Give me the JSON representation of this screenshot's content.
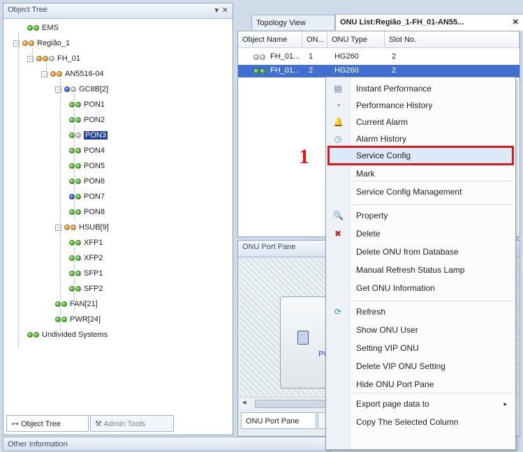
{
  "object_tree": {
    "title": "Object Tree",
    "pin_glyph": "▾",
    "close_glyph": "✕",
    "nodes": [
      {
        "label": "EMS",
        "dots": [
          "g",
          "g"
        ],
        "expander": ""
      },
      {
        "label": "Região_1",
        "dots": [
          "y",
          "y"
        ],
        "expander": "-"
      },
      {
        "label": "FH_01",
        "dots": [
          "y",
          "y",
          "w"
        ],
        "expander": "-"
      },
      {
        "label": "AN5516-04",
        "dots": [
          "y",
          "y"
        ],
        "expander": "-"
      },
      {
        "label": "GC8B[2]",
        "dots": [
          "b",
          "w"
        ],
        "expander": "-"
      },
      {
        "label": "PON1",
        "dots": [
          "g",
          "g"
        ],
        "expander": ""
      },
      {
        "label": "PON2",
        "dots": [
          "g",
          "g"
        ],
        "expander": ""
      },
      {
        "label": "PON3",
        "dots": [
          "g",
          "w"
        ],
        "expander": "",
        "selected": true
      },
      {
        "label": "PON4",
        "dots": [
          "g",
          "g"
        ],
        "expander": ""
      },
      {
        "label": "PON5",
        "dots": [
          "g",
          "g"
        ],
        "expander": ""
      },
      {
        "label": "PON6",
        "dots": [
          "g",
          "g"
        ],
        "expander": ""
      },
      {
        "label": "PON7",
        "dots": [
          "b",
          "g"
        ],
        "expander": ""
      },
      {
        "label": "PON8",
        "dots": [
          "g",
          "g"
        ],
        "expander": ""
      },
      {
        "label": "HSUB[9]",
        "dots": [
          "y",
          "y"
        ],
        "expander": "-"
      },
      {
        "label": "XFP1",
        "dots": [
          "g",
          "g"
        ],
        "expander": ""
      },
      {
        "label": "XFP2",
        "dots": [
          "g",
          "g"
        ],
        "expander": ""
      },
      {
        "label": "SFP1",
        "dots": [
          "g",
          "g"
        ],
        "expander": ""
      },
      {
        "label": "SFP2",
        "dots": [
          "g",
          "g"
        ],
        "expander": ""
      },
      {
        "label": "FAN[21]",
        "dots": [
          "g",
          "g"
        ],
        "expander": ""
      },
      {
        "label": "PWR[24]",
        "dots": [
          "g",
          "g"
        ],
        "expander": ""
      },
      {
        "label": "Undivided Systems",
        "dots": [
          "g",
          "g"
        ],
        "expander": ""
      }
    ],
    "bottom_tabs": [
      {
        "label": "Object Tree",
        "icon": "tree-icon"
      },
      {
        "label": "Admin Tools",
        "icon": "tools-icon"
      }
    ]
  },
  "other_information": {
    "title": "Other Information"
  },
  "tabs": [
    {
      "label": "Topology View"
    },
    {
      "label": "ONU List:Região_1-FH_01-AN55...",
      "close_glyph": "✕"
    }
  ],
  "onu_table": {
    "headers": [
      "Object Name",
      "ON...",
      "ONU Type",
      "Slot No."
    ],
    "rows": [
      {
        "dots": [
          "w",
          "w"
        ],
        "name": "FH_01...",
        "on": "1",
        "type": "HG260",
        "slot": "2",
        "selected": false
      },
      {
        "dots": [
          "g",
          "g"
        ],
        "name": "FH_01...",
        "on": "2",
        "type": "HG260",
        "slot": "2",
        "selected": true
      }
    ]
  },
  "onu_port_pane": {
    "title": "ONU Port Pane",
    "pw_label": "PW",
    "scroll_left": "◂",
    "bottom_tab": "ONU Port Pane"
  },
  "annotation": {
    "label": "1"
  },
  "context_menu": {
    "items": [
      {
        "label": "Instant Performance",
        "icon": "instant-performance-icon",
        "glyph": "▤"
      },
      {
        "label": "Performance History",
        "icon": "performance-history-icon",
        "glyph": "◔"
      },
      {
        "label": "Current Alarm",
        "icon": "current-alarm-icon",
        "glyph": "🔔"
      },
      {
        "label": "Alarm History",
        "icon": "alarm-history-icon",
        "glyph": "◷"
      },
      {
        "label": "Service Config",
        "highlighted": true
      },
      {
        "label": "Mark"
      },
      {
        "label": "Service Config Management"
      },
      {
        "label": "Property",
        "icon": "property-icon",
        "glyph": "🔍"
      },
      {
        "label": "Delete",
        "icon": "delete-icon",
        "glyph": "✖"
      },
      {
        "label": "Delete ONU from Database"
      },
      {
        "label": "Manual Refresh Status Lamp"
      },
      {
        "label": "Get ONU Information"
      },
      {
        "label": "Refresh",
        "icon": "refresh-icon",
        "glyph": "⟳"
      },
      {
        "label": "Show ONU User"
      },
      {
        "label": "Setting VIP ONU"
      },
      {
        "label": "Delete VIP ONU Setting"
      },
      {
        "label": "Hide ONU Port Pane"
      },
      {
        "label": "Export page data to",
        "submenu": true,
        "arrow": "▸"
      },
      {
        "label": "Copy The Selected Column"
      }
    ]
  },
  "colors": {
    "highlight_border": "#e0161b",
    "selection": "#3f6fd1",
    "menu_highlight": "#dce9f9"
  }
}
